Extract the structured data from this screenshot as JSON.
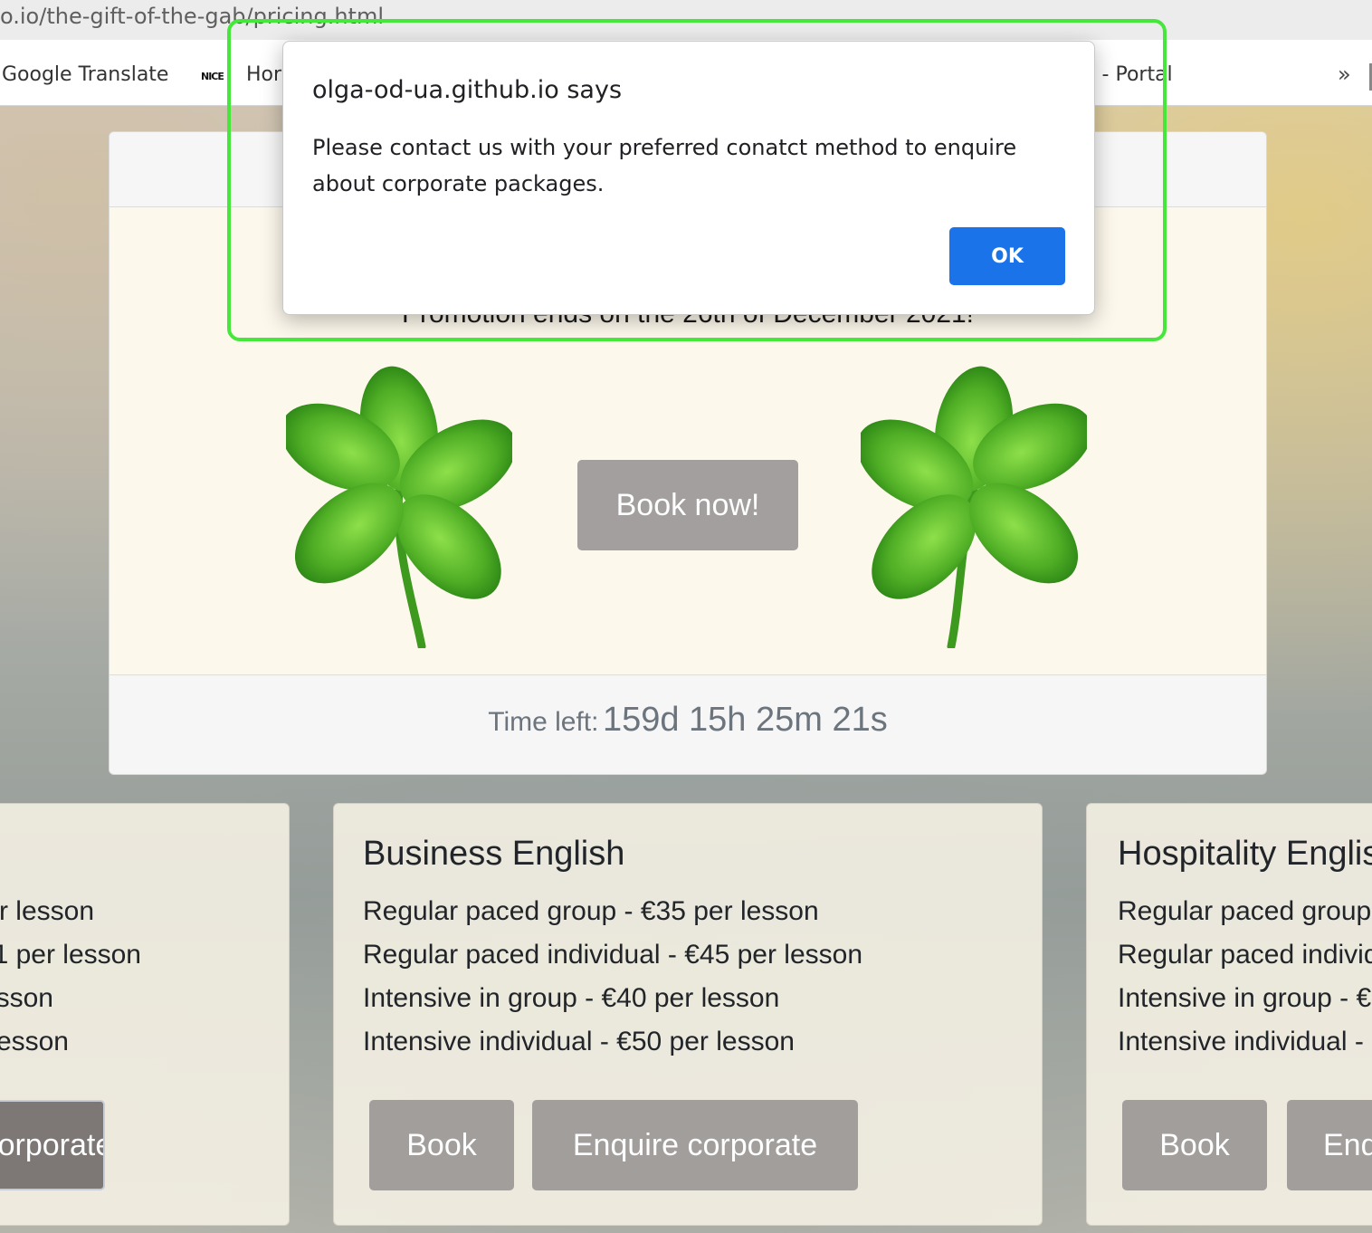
{
  "browser": {
    "url_path": "o.io/the-gift-of-the-gab/pricing.html",
    "bookmarks": [
      {
        "label": "Google Translate"
      },
      {
        "label": "Hor"
      },
      {
        "label": "e - Portal"
      }
    ],
    "overflow_label": "»"
  },
  "promo": {
    "text": "Promotion ends on the 26th of December 2021!",
    "book_label": "Book now!",
    "timer_label": "Time left:",
    "timer_value": "159d 15h 25m 21s"
  },
  "price_cards": [
    {
      "title": "",
      "lines": [
        "r lesson",
        "1 per lesson",
        "sson",
        "esson"
      ],
      "buttons": [
        "Enquire corporate"
      ]
    },
    {
      "title": "Business English",
      "lines": [
        "Regular paced group - €35 per lesson",
        "Regular paced individual - €45 per lesson",
        "Intensive in group - €40 per lesson",
        "Intensive individual - €50 per lesson"
      ],
      "buttons": [
        "Book",
        "Enquire corporate"
      ]
    },
    {
      "title": "Hospitality English",
      "lines": [
        "Regular paced group",
        "Regular paced individual",
        "Intensive in group - €",
        "Intensive individual -"
      ],
      "buttons": [
        "Book",
        "Enquire corporate"
      ]
    }
  ],
  "dialog": {
    "title": "olga-od-ua.github.io says",
    "message": "Please contact us with your preferred conatct method to enquire about corporate packages.",
    "ok_label": "OK"
  },
  "colors": {
    "accent": "#1a73e8",
    "highlight": "#45e83a",
    "button_gray": "#a19e9c",
    "clover_green": "#5cbf2a"
  },
  "icons": [
    "four-leaf-clover-icon",
    "chevron-double-right-icon"
  ]
}
